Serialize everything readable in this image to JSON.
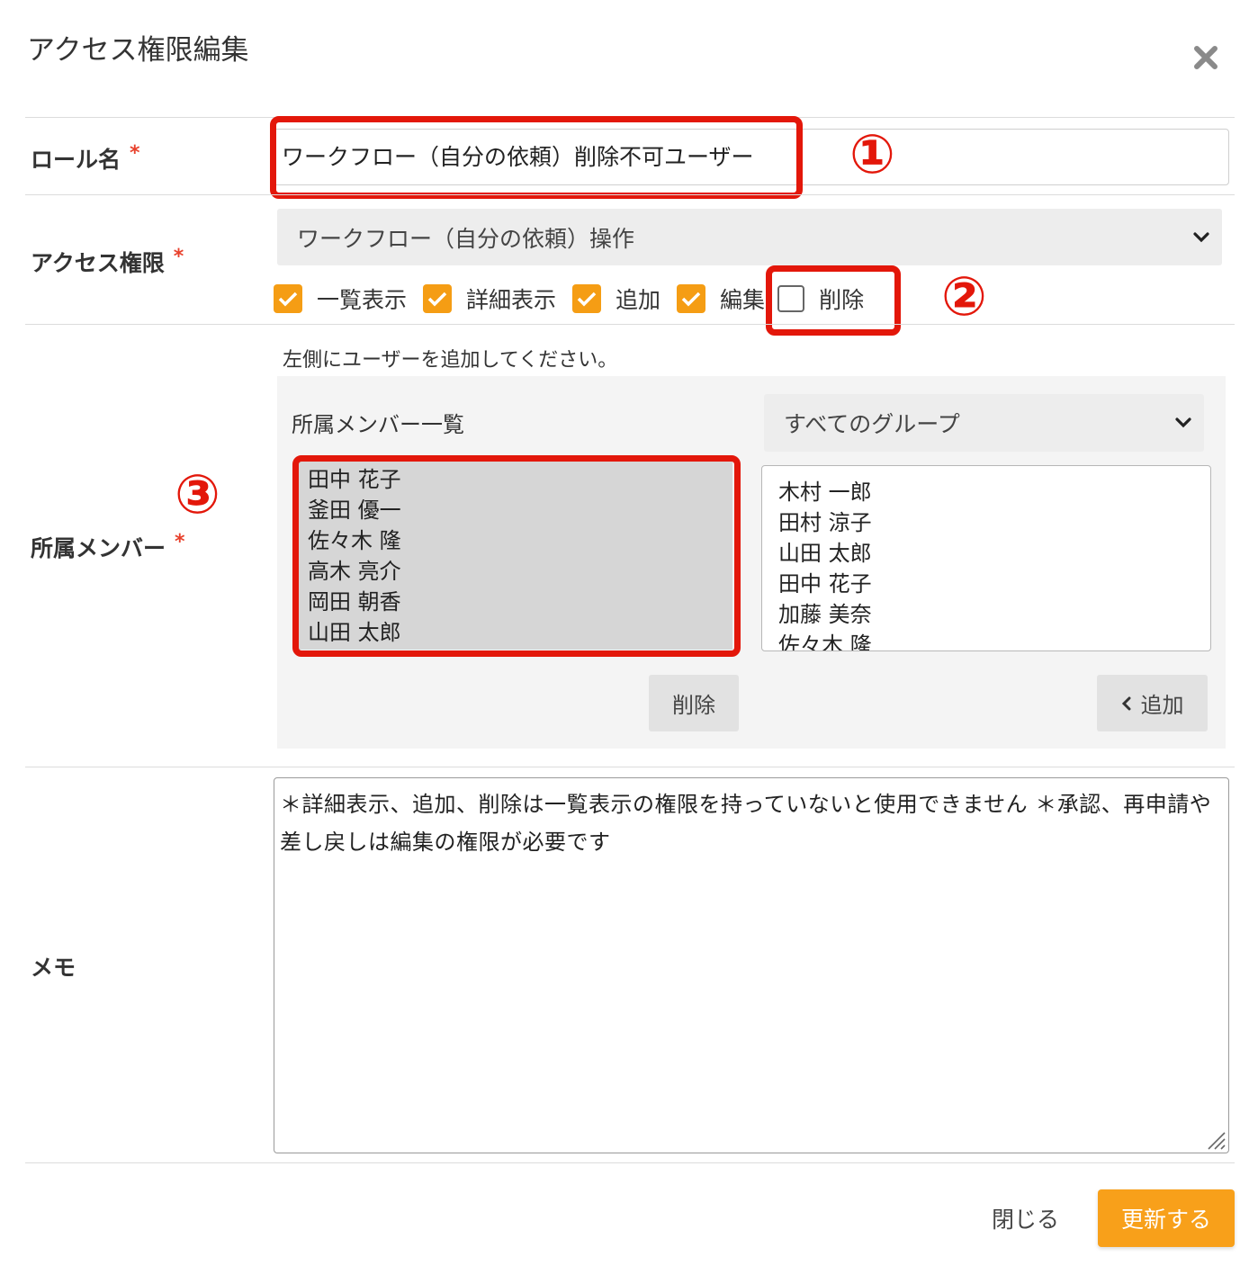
{
  "dialog": {
    "title": "アクセス権限編集",
    "close_icon": "close-icon"
  },
  "role": {
    "label": "ロール名",
    "required_mark": "*",
    "value": "ワークフロー（自分の依頼）削除不可ユーザー"
  },
  "access": {
    "label": "アクセス権限",
    "required_mark": "*",
    "selected": "ワークフロー（自分の依頼）操作",
    "permissions": [
      {
        "label": "一覧表示",
        "checked": true
      },
      {
        "label": "詳細表示",
        "checked": true
      },
      {
        "label": "追加",
        "checked": true
      },
      {
        "label": "編集",
        "checked": true
      },
      {
        "label": "削除",
        "checked": false
      }
    ]
  },
  "members": {
    "label": "所属メンバー",
    "required_mark": "*",
    "hint": "左側にユーザーを追加してください。",
    "list_title": "所属メンバー一覧",
    "group_select": "すべてのグループ",
    "assigned": [
      "田中 花子",
      "釜田 優一",
      "佐々木 隆",
      "高木 亮介",
      "岡田 朝香",
      "山田 太郎"
    ],
    "available": [
      "木村 一郎",
      "田村 涼子",
      "山田 太郎",
      "田中 花子",
      "加藤 美奈",
      "佐々木 隆"
    ],
    "remove_button": "削除",
    "add_button": "追加"
  },
  "memo": {
    "label": "メモ",
    "text": "＊詳細表示、追加、削除は一覧表示の権限を持っていないと使用できません ＊承認、再申請や差し戻しは編集の権限が必要です"
  },
  "footer": {
    "close_label": "閉じる",
    "submit_label": "更新する"
  },
  "annotations": [
    "①",
    "②",
    "③"
  ],
  "colors": {
    "accent": "#f8a01a",
    "checkbox": "#f59d14",
    "required": "#e8412c",
    "highlight_red": "#e3170a"
  }
}
